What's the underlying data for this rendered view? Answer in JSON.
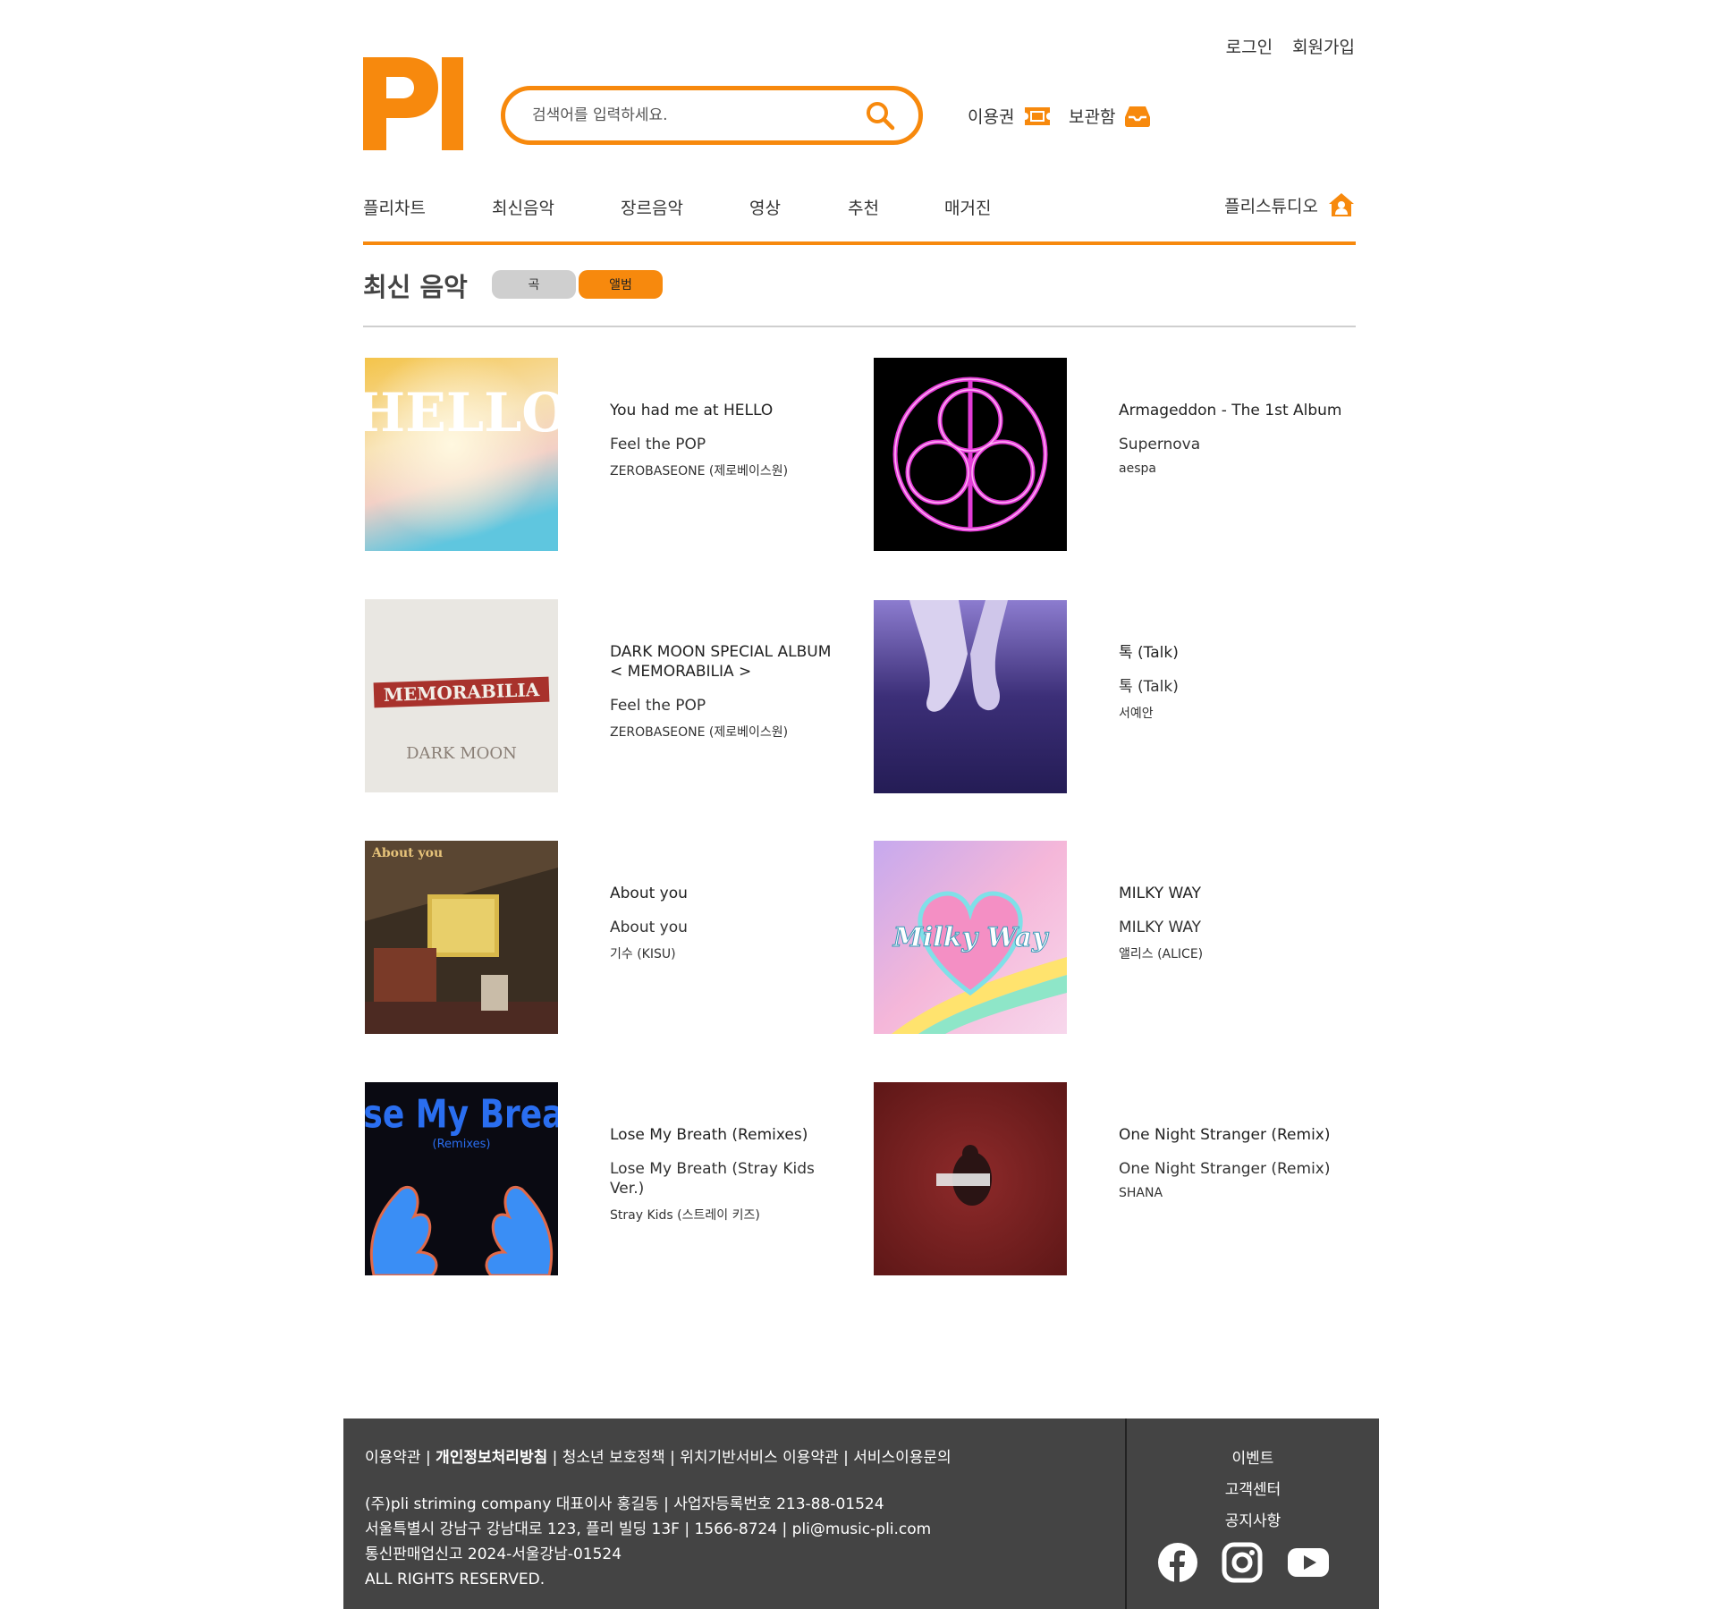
{
  "header": {
    "login": "로그인",
    "signup": "회원가입",
    "search_placeholder": "검색어를 입력하세요.",
    "ticket": "이용권",
    "storage": "보관함"
  },
  "nav": {
    "items": [
      "플리차트",
      "최신음악",
      "장르음악",
      "영상",
      "추천",
      "매거진"
    ],
    "studio": "플리스튜디오"
  },
  "section": {
    "title": "최신 음악",
    "tab_song": "곡",
    "tab_album": "앨범"
  },
  "albums": [
    {
      "title": "You had me at HELLO",
      "song": "Feel the POP",
      "artist": "ZEROBASEONE (제로베이스원)",
      "cover_text": "HELLO"
    },
    {
      "title": "Armageddon - The 1st Album",
      "song": "Supernova",
      "artist": "aespa"
    },
    {
      "title": "DARK MOON SPECIAL ALBUM\n< MEMORABILIA >",
      "song": "Feel the POP",
      "artist": "ZEROBASEONE (제로베이스원)",
      "cover_text": "MEMORABILIA",
      "cover_text2": "DARK MOON"
    },
    {
      "title": "톡 (Talk)",
      "song": "톡 (Talk)",
      "artist": "서예안"
    },
    {
      "title": "About you",
      "song": "About you",
      "artist": "기수 (KISU)",
      "cover_text": "About you"
    },
    {
      "title": "MILKY WAY",
      "song": "MILKY WAY",
      "artist": "앨리스 (ALICE)",
      "cover_text": "Milky Way"
    },
    {
      "title": "Lose My Breath (Remixes)",
      "song": "Lose My Breath (Stray Kids Ver.)",
      "artist": "Stray Kids (스트레이 키즈)",
      "cover_text": "Lose My Breath",
      "cover_text2": "(Remixes)"
    },
    {
      "title": "One Night Stranger (Remix)",
      "song": "One Night Stranger (Remix)",
      "artist": "SHANA"
    }
  ],
  "footer": {
    "terms": "이용약관",
    "privacy": "개인정보처리방침",
    "youth": "청소년 보호정책",
    "location": "위치기반서비스 이용약관",
    "inquiry": "서비스이용문의",
    "company": "(주)pli striming company 대표이사 홍길동 | 사업자등록번호 213-88-01524",
    "address": "서울특별시 강남구 강남대로 123, 플리 빌딩 13F | 1566-8724 | pli@music-pli.com",
    "license": "통신판매업신고 2024-서울강남-01524",
    "rights": "ALL RIGHTS RESERVED.",
    "event": "이벤트",
    "support": "고객센터",
    "notice": "공지사항"
  },
  "colors": {
    "accent": "#f7890d",
    "footer_bg": "#444444"
  }
}
